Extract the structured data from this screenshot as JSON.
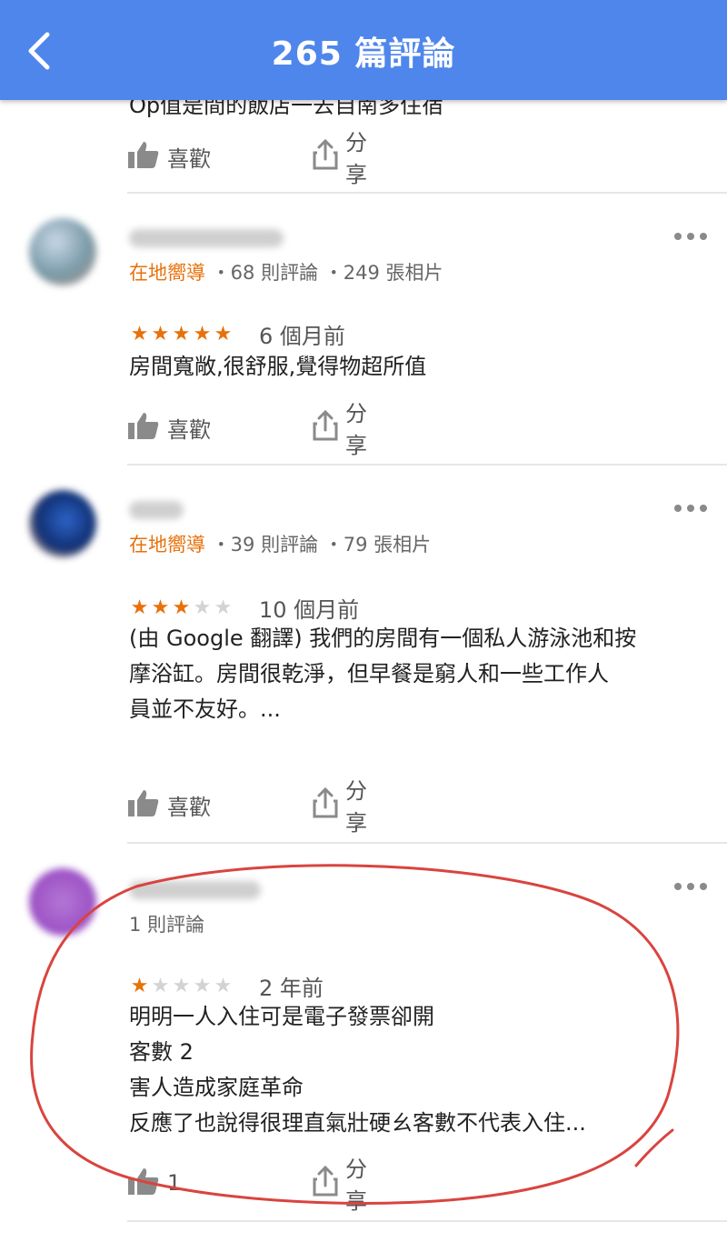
{
  "header": {
    "title": "265 篇評論"
  },
  "top_partial": {
    "text": "Op值是間的飯店一去自南多住宿"
  },
  "like_label": "喜歡",
  "share_label": "分享",
  "reviews": [
    {
      "guide_label": "在地嚮導",
      "stats": "・68 則評論 ・249 張相片",
      "stars": 5,
      "time": "6 個月前",
      "text": "房間寬敞,很舒服,覺得物超所值"
    },
    {
      "guide_label": "在地嚮導",
      "stats": "・39 則評論 ・79 張相片",
      "stars": 3,
      "time": "10 個月前",
      "lines": [
        "(由 Google 翻譯) 我們的房間有一個私人游泳池和按",
        "摩浴缸。房間很乾淨，但早餐是窮人和一些工作人",
        "員並不友好。..."
      ]
    },
    {
      "stats": "1 則評論",
      "stars": 1,
      "time": "2 年前",
      "lines": [
        "明明一人入住可是電子發票卻開",
        "客數 2",
        "害人造成家庭革命",
        "反應了也說得很理直氣壯硬ㄠ客數不代表入住..."
      ],
      "like_count": "1"
    }
  ],
  "colors": {
    "appbar": "#4f86ec",
    "accent": "#e8710a",
    "annotation": "#d9443f"
  }
}
